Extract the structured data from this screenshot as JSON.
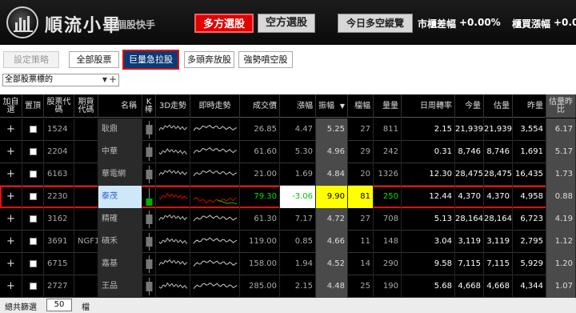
{
  "app": {
    "title": "順流小畢",
    "subtitle": "個股快手"
  },
  "header": {
    "long_button": "多方選股",
    "short_button": "空方選股",
    "today_button": "今日多空縱覽",
    "market_label": "市櫃差幅",
    "market_value": "+0.00%",
    "otc_label": "櫃買漲幅",
    "otc_value": "+0.0"
  },
  "toolbar": {
    "buttons": [
      "設定策略",
      "全部股票",
      "巨量急拉股",
      "多頭奔放股",
      "強勢噴空股"
    ],
    "active_index": 2
  },
  "filter": {
    "selected": "全部股票標的"
  },
  "table": {
    "headers": [
      "加自選",
      "置頂",
      "股票代碼",
      "期貨代碼",
      "名稱",
      "K棒",
      "3D走勢",
      "即時走勢",
      "成交價",
      "漲幅",
      "振幅",
      "▼",
      "檔幅",
      "量量",
      "日周轉率",
      "今量",
      "估量",
      "昨量",
      "估量昨比"
    ],
    "rows": [
      {
        "code": "1524",
        "fut": "",
        "name": "耿鼎",
        "price": "26.85",
        "chg": "4.47",
        "amp": "5.25",
        "tick": "27",
        "vol": "811",
        "turn": "2.15",
        "today": "21,939",
        "est": "21,939",
        "yest": "3,554",
        "ratio": "6.17"
      },
      {
        "code": "2204",
        "fut": "",
        "name": "中華",
        "price": "61.60",
        "chg": "5.30",
        "amp": "4.96",
        "tick": "29",
        "vol": "242",
        "turn": "0.31",
        "today": "8,746",
        "est": "8,746",
        "yest": "1,691",
        "ratio": "5.17"
      },
      {
        "code": "6163",
        "fut": "",
        "name": "華電網",
        "price": "21.00",
        "chg": "1.69",
        "amp": "4.84",
        "tick": "20",
        "vol": "1326",
        "turn": "12.30",
        "today": "28,475",
        "est": "28,475",
        "yest": "16,435",
        "ratio": "1.73"
      },
      {
        "code": "2230",
        "fut": "",
        "name": "泰茂",
        "price": "79.30",
        "chg": "-3.06",
        "amp": "9.90",
        "tick": "81",
        "vol": "250",
        "turn": "12.44",
        "today": "4,370",
        "est": "4,370",
        "yest": "4,958",
        "ratio": "0.88"
      },
      {
        "code": "3162",
        "fut": "",
        "name": "精確",
        "price": "61.30",
        "chg": "7.17",
        "amp": "4.72",
        "tick": "27",
        "vol": "708",
        "turn": "5.13",
        "today": "28,164",
        "est": "28,164",
        "yest": "6,723",
        "ratio": "4.19"
      },
      {
        "code": "3691",
        "fut": "NGF1",
        "name": "碩禾",
        "price": "119.00",
        "chg": "0.85",
        "amp": "4.66",
        "tick": "11",
        "vol": "148",
        "turn": "3.04",
        "today": "3,119",
        "est": "3,119",
        "yest": "2,795",
        "ratio": "1.12"
      },
      {
        "code": "6715",
        "fut": "",
        "name": "嘉基",
        "price": "158.00",
        "chg": "1.94",
        "amp": "4.52",
        "tick": "14",
        "vol": "290",
        "turn": "9.58",
        "today": "7,115",
        "est": "7,115",
        "yest": "5,929",
        "ratio": "1.20"
      },
      {
        "code": "2727",
        "fut": "",
        "name": "王品",
        "price": "285.00",
        "chg": "2.15",
        "amp": "4.48",
        "tick": "25",
        "vol": "190",
        "turn": "5.68",
        "today": "4,668",
        "est": "4,668",
        "yest": "4,344",
        "ratio": "1.07"
      }
    ],
    "selected_row": 3
  },
  "footer": {
    "label": "總共篩選",
    "count": "50",
    "unit": "檔"
  },
  "colors": {
    "red": "#e00000",
    "yellow": "#ffff00",
    "green": "#00c000",
    "selection_outline": "#e01010"
  }
}
